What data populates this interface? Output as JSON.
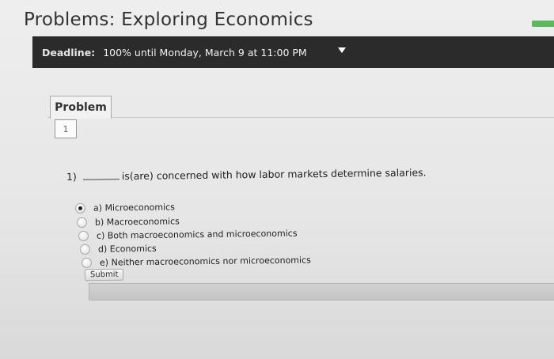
{
  "page": {
    "title": "Problems: Exploring Economics"
  },
  "deadline": {
    "label": "Deadline:",
    "value": "100% until Monday, March 9 at 11:00 PM"
  },
  "problem_tab": {
    "label": "Problem",
    "number": "1"
  },
  "question": {
    "number": "1)",
    "text": "is(are) concerned with how labor markets determine salaries."
  },
  "options": [
    {
      "label": "a) Microeconomics",
      "selected": true
    },
    {
      "label": "b) Macroeconomics",
      "selected": false
    },
    {
      "label": "c) Both macroeconomics and microeconomics",
      "selected": false
    },
    {
      "label": "d) Economics",
      "selected": false
    },
    {
      "label": "e) Neither macroeconomics nor microeconomics",
      "selected": false
    }
  ],
  "submit": {
    "label": "Submit"
  },
  "colors": {
    "deadline_bar": "#2b2b2b",
    "accent_green": "#5cb85c"
  }
}
